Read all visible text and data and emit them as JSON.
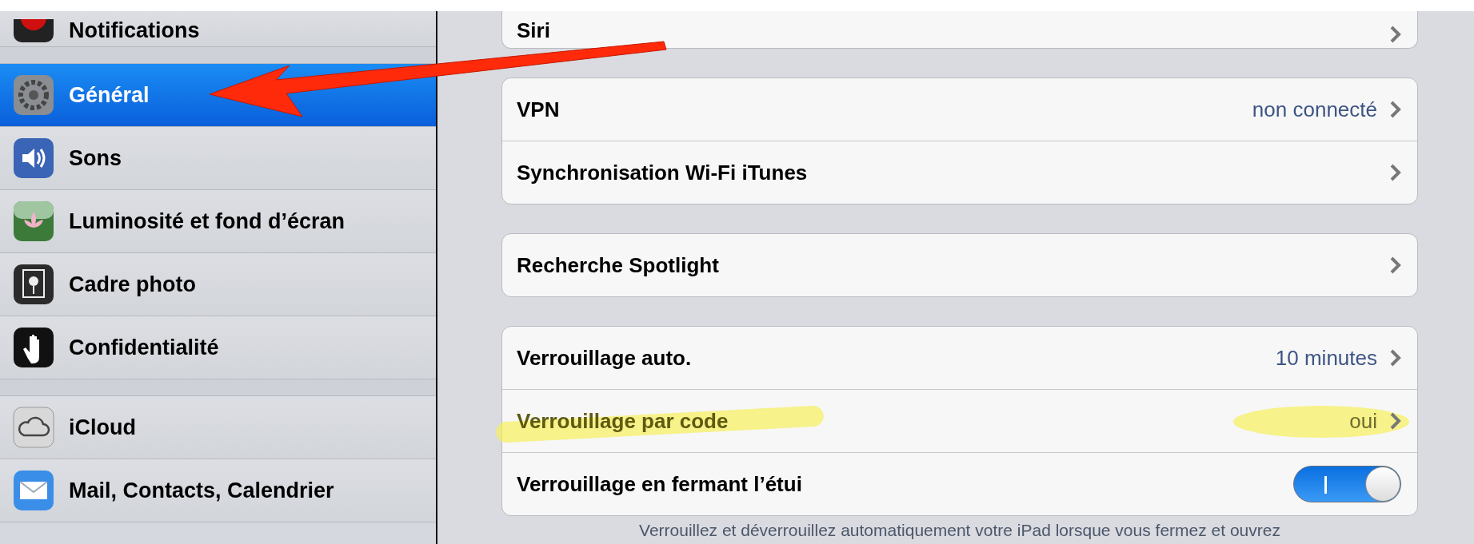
{
  "sidebar": {
    "sections": [
      {
        "items": [
          {
            "label": "Notifications",
            "kind": "notifications",
            "selected": false
          }
        ]
      },
      {
        "items": [
          {
            "label": "Général",
            "kind": "general",
            "selected": true
          },
          {
            "label": "Sons",
            "kind": "sounds",
            "selected": false
          },
          {
            "label": "Luminosité et fond d’écran",
            "kind": "wallpaper",
            "selected": false
          },
          {
            "label": "Cadre photo",
            "kind": "frame",
            "selected": false
          },
          {
            "label": "Confidentialité",
            "kind": "privacy",
            "selected": false
          }
        ]
      },
      {
        "items": [
          {
            "label": "iCloud",
            "kind": "cloud",
            "selected": false
          },
          {
            "label": "Mail, Contacts, Calendrier",
            "kind": "mail",
            "selected": false
          }
        ]
      }
    ]
  },
  "groups": [
    {
      "rows": [
        {
          "label": "Siri",
          "kind": "link",
          "highlighted": false
        }
      ]
    },
    {
      "rows": [
        {
          "label": "VPN",
          "kind": "link",
          "value": "non connecté",
          "highlighted": false
        },
        {
          "label": "Synchronisation Wi-Fi iTunes",
          "kind": "link",
          "highlighted": false
        }
      ]
    },
    {
      "rows": [
        {
          "label": "Recherche Spotlight",
          "kind": "link",
          "highlighted": false
        }
      ]
    },
    {
      "rows": [
        {
          "label": "Verrouillage auto.",
          "kind": "link",
          "value": "10 minutes",
          "highlighted": false
        },
        {
          "label": "Verrouillage par code",
          "kind": "link",
          "value": "oui",
          "highlighted": true
        },
        {
          "label": "Verrouillage en fermant l’étui",
          "kind": "toggle",
          "on": true,
          "highlighted": false
        }
      ],
      "footer": "Verrouillez et déverrouillez automatiquement votre iPad lorsque vous fermez et ouvrez"
    }
  ]
}
